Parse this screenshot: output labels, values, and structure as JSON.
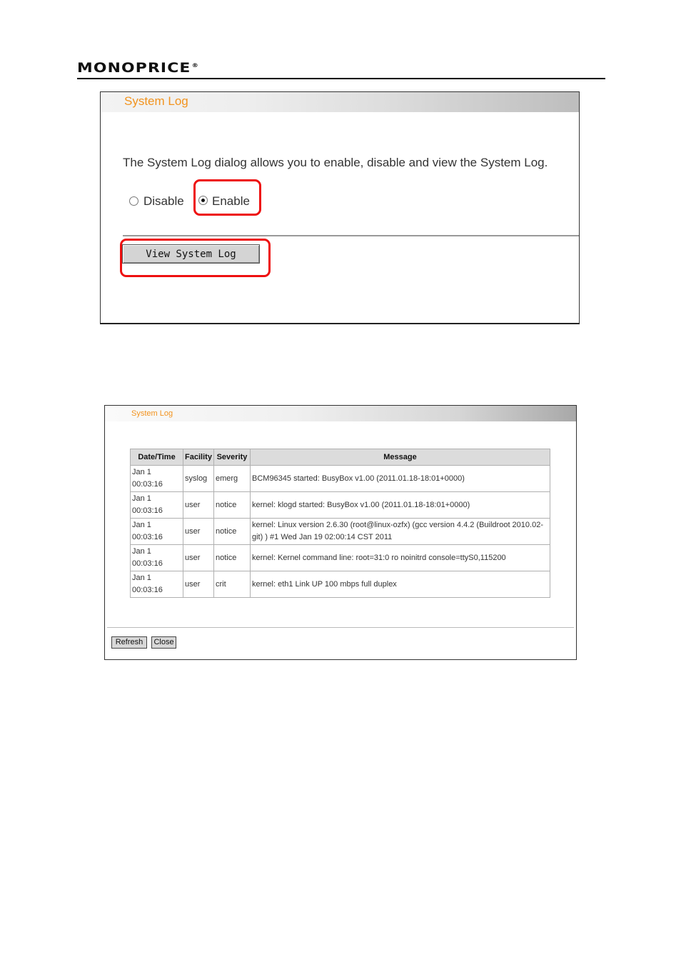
{
  "header": {
    "brand": "MONOPRICE",
    "brand_mark": "®"
  },
  "panel1": {
    "title": "System Log",
    "description": "The System Log dialog allows you to enable, disable and view the System Log.",
    "options": [
      {
        "label": "Disable",
        "checked": false
      },
      {
        "label": "Enable",
        "checked": true
      }
    ],
    "view_button": "View System Log"
  },
  "panel2": {
    "title": "System Log",
    "columns": [
      "Date/Time",
      "Facility",
      "Severity",
      "Message"
    ],
    "rows": [
      {
        "date": "Jan 1",
        "time": "00:03:16",
        "facility": "syslog",
        "severity": "emerg",
        "message": "BCM96345 started: BusyBox v1.00 (2011.01.18-18:01+0000)"
      },
      {
        "date": "Jan 1",
        "time": "00:03:16",
        "facility": "user",
        "severity": "notice",
        "message": "kernel: klogd started: BusyBox v1.00 (2011.01.18-18:01+0000)"
      },
      {
        "date": "Jan 1",
        "time": "00:03:16",
        "facility": "user",
        "severity": "notice",
        "message": "kernel: Linux version 2.6.30 (root@linux-ozfx) (gcc version 4.4.2 (Buildroot 2010.02-git) ) #1 Wed Jan 19 02:00:14 CST 2011"
      },
      {
        "date": "Jan 1",
        "time": "00:03:16",
        "facility": "user",
        "severity": "notice",
        "message": "kernel: Kernel command line: root=31:0 ro noinitrd console=ttyS0,115200"
      },
      {
        "date": "Jan 1",
        "time": "00:03:16",
        "facility": "user",
        "severity": "crit",
        "message": "kernel: eth1 Link UP 100 mbps full duplex"
      }
    ],
    "refresh_button": "Refresh",
    "close_button": "Close"
  },
  "colors": {
    "title_orange": "#f2931e",
    "highlight_red": "#ee1010"
  }
}
